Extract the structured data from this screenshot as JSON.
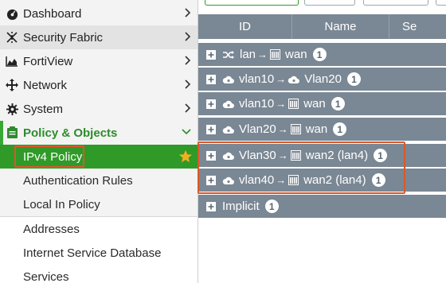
{
  "sidebar": {
    "items": [
      {
        "label": "Dashboard"
      },
      {
        "label": "Security Fabric"
      },
      {
        "label": "FortiView"
      },
      {
        "label": "Network"
      },
      {
        "label": "System"
      },
      {
        "label": "Policy & Objects"
      }
    ],
    "subitems": [
      {
        "label": "IPv4 Policy"
      },
      {
        "label": "Authentication Rules"
      },
      {
        "label": "Local In Policy"
      },
      {
        "label": "Addresses"
      },
      {
        "label": "Internet Service Database"
      },
      {
        "label": "Services"
      }
    ]
  },
  "table": {
    "columns": [
      "ID",
      "Name",
      "Se"
    ],
    "groups": [
      {
        "src": "lan",
        "dst": "wan",
        "count": "1"
      },
      {
        "src": "vlan10",
        "dst": "Vlan20",
        "count": "1"
      },
      {
        "src": "vlan10",
        "dst": "wan",
        "count": "1"
      },
      {
        "src": "Vlan20",
        "dst": "wan",
        "count": "1"
      },
      {
        "src": "Vlan30",
        "dst": "wan2 (lan4)",
        "count": "1"
      },
      {
        "src": "vlan40",
        "dst": "wan2 (lan4)",
        "count": "1"
      },
      {
        "label": "Implicit",
        "count": "1"
      }
    ],
    "arrow": "→"
  },
  "colors": {
    "accent_green": "#2f9a28",
    "highlight": "#d9582b",
    "group_row": "#7a8794"
  }
}
